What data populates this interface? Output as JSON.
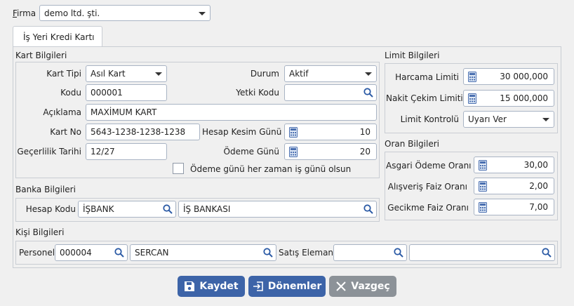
{
  "firma": {
    "label": "Firma",
    "value": "demo ltd. şti."
  },
  "tab": {
    "label": "İş Yeri Kredi Kartı"
  },
  "kart": {
    "title": "Kart Bilgileri",
    "kart_tipi_label": "Kart Tipi",
    "kart_tipi_value": "Asıl Kart",
    "durum_label": "Durum",
    "durum_value": "Aktif",
    "kodu_label": "Kodu",
    "kodu_value": "000001",
    "yetki_kodu_label": "Yetki Kodu",
    "yetki_kodu_value": "",
    "aciklama_label": "Açıklama",
    "aciklama_value": "MAXİMUM KART",
    "kart_no_label": "Kart No",
    "kart_no_value": "5643-1238-1238-1238",
    "hesap_kesim_label": "Hesap Kesim Günü",
    "hesap_kesim_value": "10",
    "gecerlilik_label": "Geçerlilik Tarihi",
    "gecerlilik_value": "12/27",
    "odeme_gunu_label": "Ödeme Günü",
    "odeme_gunu_value": "20",
    "checkbox_label": "Ödeme günü her zaman iş günü olsun"
  },
  "banka": {
    "title": "Banka Bilgileri",
    "hesap_kodu_label": "Hesap Kodu",
    "hesap_kodu_value": "İŞBANK",
    "hesap_adi_value": "İŞ BANKASI"
  },
  "kisi": {
    "title": "Kişi Bilgileri",
    "personel_label": "Personel",
    "personel_code": "000004",
    "personel_name": "SERCAN",
    "satis_label": "Satış Elemanı",
    "satis_code": "",
    "satis_name": ""
  },
  "limit": {
    "title": "Limit Bilgileri",
    "harcama_label": "Harcama Limiti",
    "harcama_value": "30 000,000",
    "nakit_label": "Nakit Çekim Limiti",
    "nakit_value": "15 000,000",
    "kontrol_label": "Limit Kontrolü",
    "kontrol_value": "Uyarı Ver"
  },
  "oran": {
    "title": "Oran Bilgileri",
    "asgari_label": "Asgari Ödeme Oranı",
    "asgari_value": "30,00",
    "alisveris_label": "Alışveriş Faiz Oranı",
    "alisveris_value": "2,00",
    "gecikme_label": "Gecikme Faiz Oranı",
    "gecikme_value": "7,00"
  },
  "buttons": {
    "kaydet": "Kaydet",
    "donemler": "Dönemler",
    "vazgec": "Vazgeç"
  },
  "colors": {
    "primary": "#3d64a8",
    "disabled": "#8c9298"
  }
}
